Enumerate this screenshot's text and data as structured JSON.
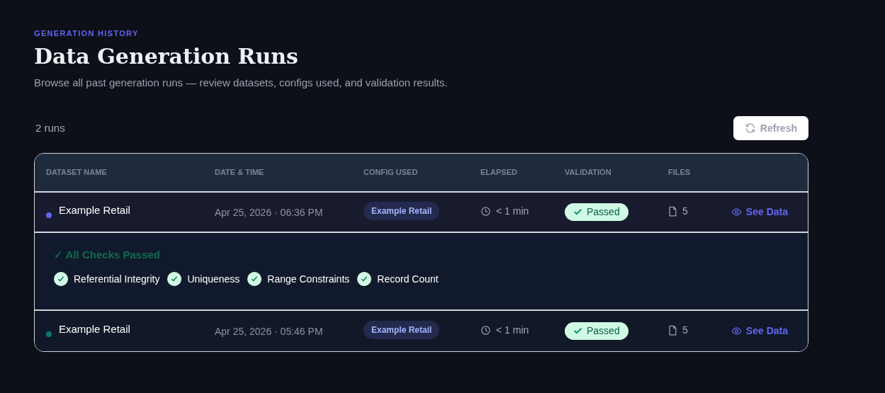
{
  "eyebrow": "GENERATION HISTORY",
  "title": "Data Generation Runs",
  "subtitle": "Browse all past generation runs — review datasets, configs used, and validation results.",
  "run_count": "2 runs",
  "refresh_button": "Refresh",
  "table": {
    "columns": [
      "DATASET NAME",
      "DATE & TIME",
      "CONFIG USED",
      "ELAPSED",
      "VALIDATION",
      "FILES"
    ],
    "rows": [
      {
        "name": "Example Retail",
        "color": "#6366f1",
        "date": "Apr 25, 2026 · 06:36 PM",
        "config": "Example Retail",
        "elapsed": "< 1 min",
        "validation": "Passed",
        "files": "5",
        "action": "See Data",
        "details": {
          "summary": "✓ All Checks Passed",
          "checks": [
            "Referential Integrity",
            "Uniqueness",
            "Range Constraints",
            "Record Count"
          ]
        }
      },
      {
        "name": "Example Retail",
        "color": "#0f766e",
        "date": "Apr 25, 2026 · 05:46 PM",
        "config": "Example Retail",
        "elapsed": "< 1 min",
        "validation": "Passed",
        "files": "5",
        "action": "See Data"
      }
    ]
  }
}
